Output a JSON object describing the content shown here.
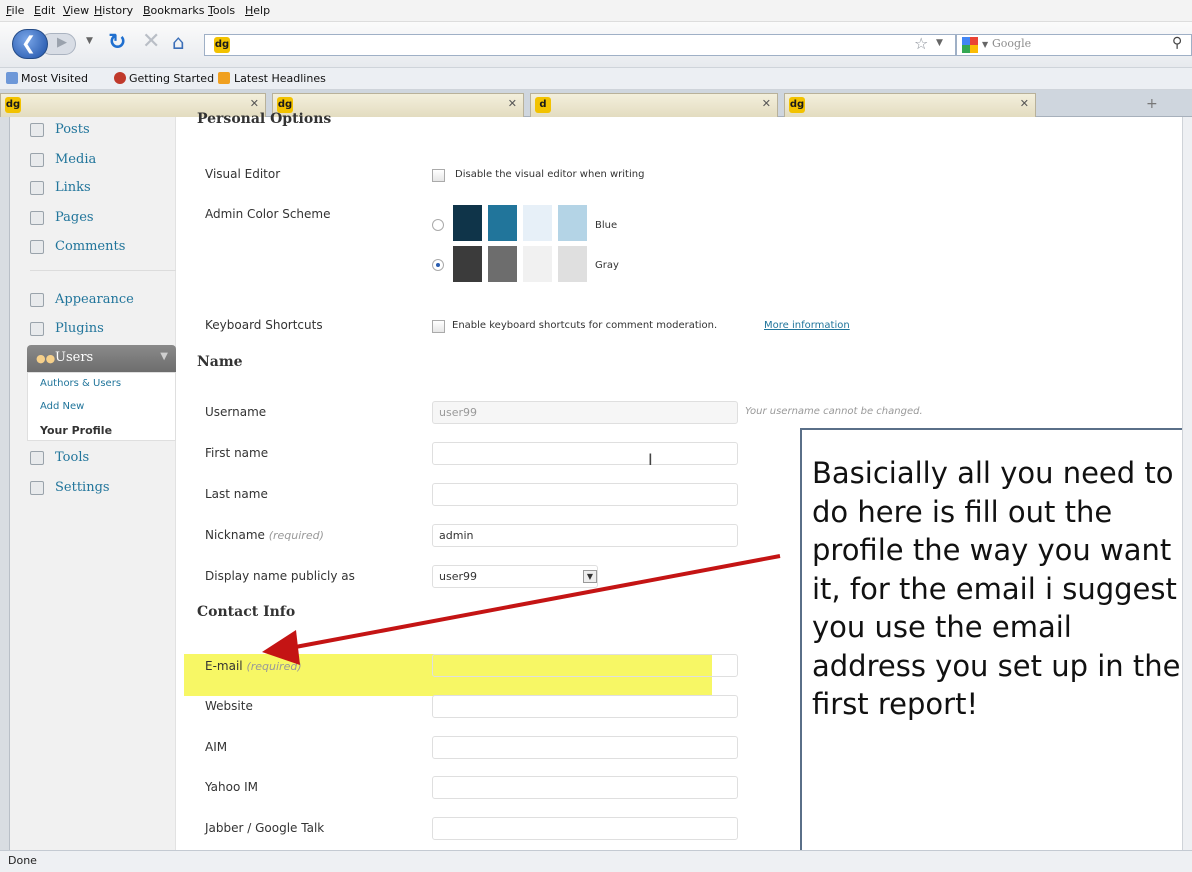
{
  "browser": {
    "menu": [
      "File",
      "Edit",
      "View",
      "History",
      "Bookmarks",
      "Tools",
      "Help"
    ],
    "search_placeholder": "Google",
    "bookmarks": [
      "Most Visited",
      "Getting Started",
      "Latest Headlines"
    ],
    "tabs": [
      {
        "favicon": "dg"
      },
      {
        "favicon": "dg"
      },
      {
        "favicon": "d"
      },
      {
        "favicon": "dg"
      }
    ],
    "url_favicon": "dg",
    "status": "Done"
  },
  "sidebar": {
    "items": [
      {
        "label": "Posts",
        "icon": "pin-icon"
      },
      {
        "label": "Media",
        "icon": "media-icon"
      },
      {
        "label": "Links",
        "icon": "link-icon"
      },
      {
        "label": "Pages",
        "icon": "pages-icon"
      },
      {
        "label": "Comments",
        "icon": "comments-icon"
      },
      {
        "label": "Appearance",
        "icon": "appearance-icon"
      },
      {
        "label": "Plugins",
        "icon": "plugin-icon"
      }
    ],
    "users": {
      "label": "Users",
      "submenu": [
        "Authors & Users",
        "Add New",
        "Your Profile"
      ]
    },
    "items_after": [
      {
        "label": "Tools",
        "icon": "tools-icon"
      },
      {
        "label": "Settings",
        "icon": "settings-icon"
      }
    ]
  },
  "personal_options": {
    "heading": "Personal Options",
    "visual_editor_label": "Visual Editor",
    "visual_editor_option": "Disable the visual editor when writing",
    "color_scheme_label": "Admin Color Scheme",
    "schemes": [
      {
        "name": "Blue",
        "colors": [
          "#0f3449",
          "#21759b",
          "#e7f0f8",
          "#b4d4e6"
        ],
        "selected": false
      },
      {
        "name": "Gray",
        "colors": [
          "#3b3b3b",
          "#6d6d6d",
          "#f1f1f1",
          "#dfdfdf"
        ],
        "selected": true
      }
    ],
    "keyboard_label": "Keyboard Shortcuts",
    "keyboard_option": "Enable keyboard shortcuts for comment moderation.",
    "more_info": "More information"
  },
  "name_section": {
    "heading": "Name",
    "username_label": "Username",
    "username_value": "user99",
    "username_note": "Your username cannot be changed.",
    "first_name_label": "First name",
    "last_name_label": "Last name",
    "nickname_label": "Nickname",
    "nickname_req": "(required)",
    "nickname_value": "admin",
    "display_label": "Display name publicly as",
    "display_value": "user99"
  },
  "contact_section": {
    "heading": "Contact Info",
    "email_label": "E-mail",
    "email_req": "(required)",
    "website_label": "Website",
    "aim_label": "AIM",
    "yahoo_label": "Yahoo IM",
    "jabber_label": "Jabber / Google Talk"
  },
  "callout": {
    "text": "Basicially all you need to do here is fill out the profile the way you want it, for the email i suggest you use the email address you set up in the first report!"
  },
  "colors": {
    "link": "#21759b",
    "highlight": "#f6f64a",
    "arrow": "#c41414"
  }
}
